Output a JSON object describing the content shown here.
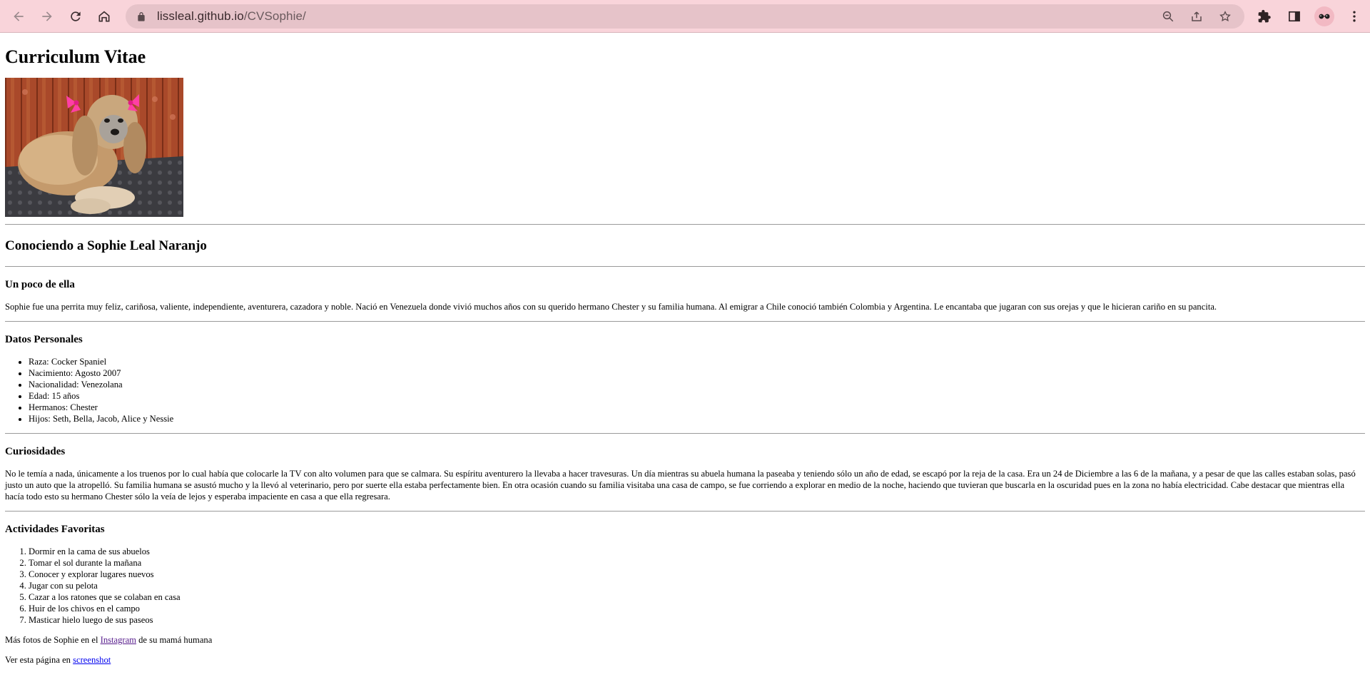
{
  "browser": {
    "url_host": "lissleal.github.io",
    "url_path": "/CVSophie/",
    "theme_color": "#f9d4da"
  },
  "cv": {
    "title": "Curriculum Vitae",
    "photo_alt": "Sophie",
    "heading": "Conociendo a Sophie Leal Naranjo",
    "about": {
      "title": "Un poco de ella",
      "text": "Sophie fue una perrita muy feliz, cariñosa, valiente, independiente, aventurera, cazadora y noble. Nació en Venezuela donde vivió muchos años con su querido hermano Chester y su familia humana. Al emigrar a Chile conoció también Colombia y Argentina. Le encantaba que jugaran con sus orejas y que le hicieran cariño en su pancita."
    },
    "personal": {
      "title": "Datos Personales",
      "items": [
        "Raza: Cocker Spaniel",
        "Nacimiento: Agosto 2007",
        "Nacionalidad: Venezolana",
        "Edad: 15 años",
        "Hermanos: Chester",
        "Hijos: Seth, Bella, Jacob, Alice y Nessie"
      ]
    },
    "curiosities": {
      "title": "Curiosidades",
      "text": "No le temía a nada, únicamente a los truenos por lo cual había que colocarle la TV con alto volumen para que se calmara. Su espíritu aventurero la llevaba a hacer travesuras. Un día mientras su abuela humana la paseaba y teniendo sólo un año de edad, se escapó por la reja de la casa. Era un 24 de Diciembre a las 6 de la mañana, y a pesar de que las calles estaban solas, pasó justo un auto que la atropelló. Su familia humana se asustó mucho y la llevó al veterinario, pero por suerte ella estaba perfectamente bien. En otra ocasión cuando su familia visitaba una casa de campo, se fue corriendo a explorar en medio de la noche, haciendo que tuvieran que buscarla en la oscuridad pues en la zona no había electricidad. Cabe destacar que mientras ella hacía todo esto su hermano Chester sólo la veía de lejos y esperaba impaciente en casa a que ella regresara."
    },
    "activities": {
      "title": "Actividades Favoritas",
      "items": [
        "Dormir en la cama de sus abuelos",
        "Tomar el sol durante la mañana",
        "Conocer y explorar lugares nuevos",
        "Jugar con su pelota",
        "Cazar a los ratones que se colaban en casa",
        "Huir de los chivos en el campo",
        "Masticar hielo luego de sus paseos"
      ]
    },
    "instagram_line": {
      "before": "Más fotos de Sophie en el ",
      "link": "Instagram",
      "after": " de su mamá humana"
    },
    "screenshot_line": {
      "before": "Ver esta página en ",
      "link": "screenshot"
    }
  }
}
